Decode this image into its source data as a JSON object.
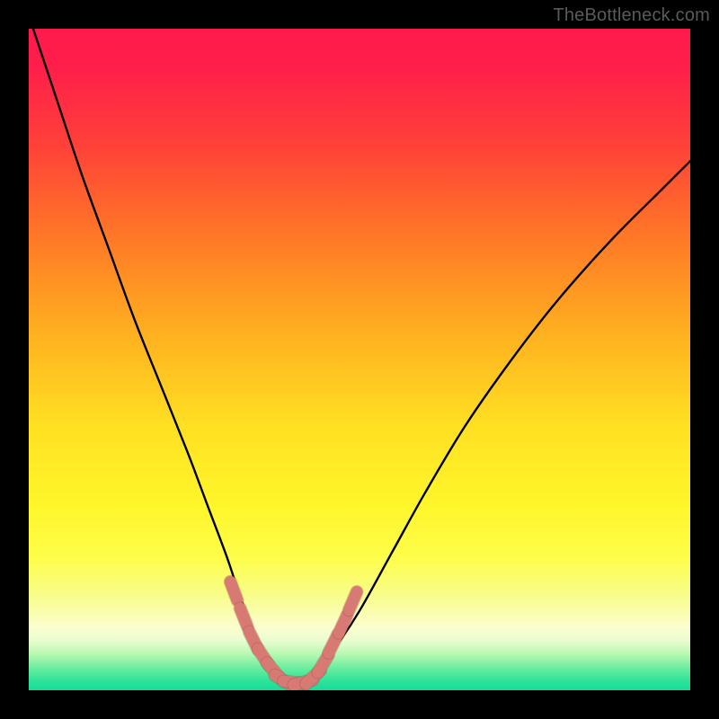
{
  "watermark": "TheBottleneck.com",
  "colors": {
    "frame": "#000000",
    "gradient_stops": [
      {
        "offset": 0.0,
        "color": "#ff1a4d"
      },
      {
        "offset": 0.06,
        "color": "#ff1f4a"
      },
      {
        "offset": 0.18,
        "color": "#ff4238"
      },
      {
        "offset": 0.32,
        "color": "#ff7a26"
      },
      {
        "offset": 0.46,
        "color": "#ffb020"
      },
      {
        "offset": 0.6,
        "color": "#ffe022"
      },
      {
        "offset": 0.72,
        "color": "#fff62a"
      },
      {
        "offset": 0.8,
        "color": "#fdfd4a"
      },
      {
        "offset": 0.86,
        "color": "#f8fd8f"
      },
      {
        "offset": 0.905,
        "color": "#fcfece"
      },
      {
        "offset": 0.925,
        "color": "#e9fdd0"
      },
      {
        "offset": 0.945,
        "color": "#b8f8b2"
      },
      {
        "offset": 0.965,
        "color": "#70eea0"
      },
      {
        "offset": 0.985,
        "color": "#30e39a"
      },
      {
        "offset": 1.0,
        "color": "#17dd97"
      }
    ],
    "curve": "#000000",
    "marker_fill": "#d77a73",
    "marker_stroke": "#a14b46"
  },
  "chart_data": {
    "type": "line",
    "title": "",
    "xlabel": "",
    "ylabel": "",
    "xlim": [
      0,
      100
    ],
    "ylim": [
      0,
      100
    ],
    "series": [
      {
        "name": "bottleneck-curve",
        "x": [
          0,
          4,
          8,
          12,
          16,
          20,
          24,
          27,
          30,
          32,
          34,
          36,
          37.5,
          39,
          41,
          43,
          46,
          50,
          55,
          60,
          66,
          73,
          80,
          88,
          96,
          100
        ],
        "values": [
          102,
          90,
          78,
          67,
          56,
          46,
          36,
          28,
          20,
          14,
          9,
          5,
          2.5,
          1.2,
          1.2,
          2.5,
          6,
          12,
          21,
          30,
          40,
          50,
          59,
          68,
          76,
          80
        ]
      }
    ],
    "markers": [
      {
        "x": 31.0,
        "y": 15.0
      },
      {
        "x": 32.5,
        "y": 11.0
      },
      {
        "x": 34.0,
        "y": 7.5
      },
      {
        "x": 35.5,
        "y": 5.0
      },
      {
        "x": 37.0,
        "y": 3.0
      },
      {
        "x": 38.5,
        "y": 1.5
      },
      {
        "x": 40.0,
        "y": 1.2
      },
      {
        "x": 41.5,
        "y": 1.2
      },
      {
        "x": 43.0,
        "y": 2.0
      },
      {
        "x": 44.5,
        "y": 4.0
      },
      {
        "x": 46.0,
        "y": 7.0
      },
      {
        "x": 47.5,
        "y": 10.0
      },
      {
        "x": 49.0,
        "y": 13.5
      }
    ],
    "min_x": 40,
    "grid": false,
    "legend": false
  }
}
